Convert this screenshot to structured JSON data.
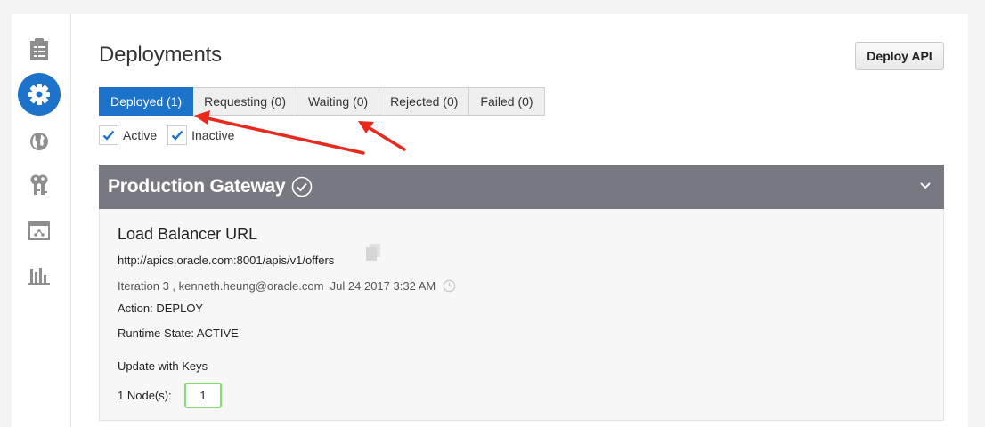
{
  "page": {
    "title": "Deployments"
  },
  "toolbar": {
    "deploy_label": "Deploy API"
  },
  "tabs": [
    {
      "label": "Deployed (1)",
      "active": true
    },
    {
      "label": "Requesting (0)",
      "active": false
    },
    {
      "label": "Waiting (0)",
      "active": false
    },
    {
      "label": "Rejected (0)",
      "active": false
    },
    {
      "label": "Failed (0)",
      "active": false
    }
  ],
  "filters": [
    {
      "label": "Active",
      "checked": true
    },
    {
      "label": "Inactive",
      "checked": true
    }
  ],
  "sidebar": {
    "items": [
      {
        "icon": "api-list-icon",
        "active": false
      },
      {
        "icon": "gear-icon",
        "active": true
      },
      {
        "icon": "globe-icon",
        "active": false
      },
      {
        "icon": "keys-icon",
        "active": false
      },
      {
        "icon": "calendar-icon",
        "active": false
      },
      {
        "icon": "bar-chart-icon",
        "active": false
      }
    ]
  },
  "panel": {
    "title": "Production Gateway",
    "load_balancer_title": "Load Balancer URL",
    "url": "http://apics.oracle.com:8001/apis/v1/offers",
    "meta": "Iteration 3 , kenneth.heung@oracle.com  Jul 24 2017 3:32 AM",
    "action": "Action: DEPLOY",
    "runtime_state": "Runtime State: ACTIVE",
    "update_keys": "Update with Keys",
    "nodes_label": "1 Node(s):",
    "nodes_value": "1"
  },
  "colors": {
    "accent": "#1d73c9",
    "panel_header": "#777880",
    "annotation": "#e8291c",
    "node_border": "#8bd97b"
  }
}
